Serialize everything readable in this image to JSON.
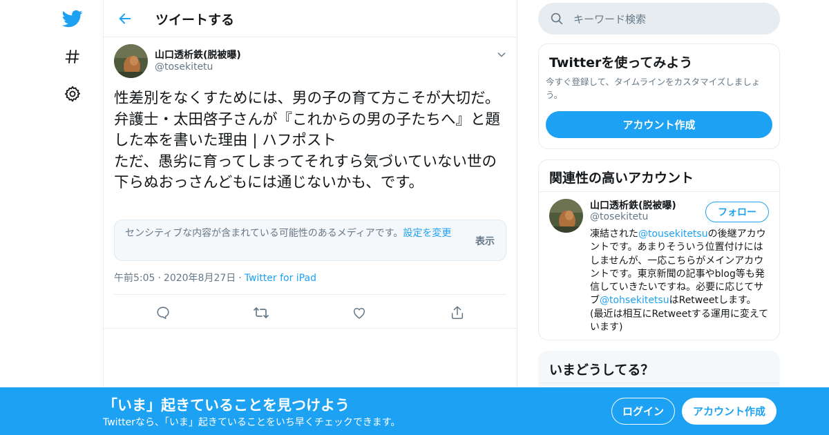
{
  "colors": {
    "accent": "#1da1f2",
    "text": "#14171a",
    "muted": "#657786",
    "border": "#e6ecf0"
  },
  "nav": {
    "icons": [
      "twitter-bird-icon",
      "hashtag-icon",
      "gear-icon"
    ]
  },
  "header": {
    "title": "ツイートする"
  },
  "tweet": {
    "author_name": "山口透析鉄(脱被曝)",
    "author_handle": "@tosekitetu",
    "text": "性差別をなくすためには、男の子の育て方こそが大切だ。弁護士・太田啓子さんが『これからの男の子たちへ』と題した本を書いた理由 | ハフポスト\nただ、愚劣に育ってしまってそれすら気づいていない世の下らぬおっさんどもには通じないかも、です。",
    "sensitive_text": "センシティブな内容が含まれている可能性のあるメディアです。",
    "sensitive_link": "設定を変更",
    "sensitive_show": "表示",
    "time": "午前5:05",
    "date": "2020年8月27日",
    "meta_sep": "·",
    "via": "Twitter for iPad",
    "actions": [
      "reply-icon",
      "retweet-icon",
      "like-icon",
      "share-icon"
    ]
  },
  "search": {
    "placeholder": "キーワード検索"
  },
  "signup_card": {
    "title": "Twitterを使ってみよう",
    "description": "今すぐ登録して、タイムラインをカスタマイズしましょう。",
    "button": "アカウント作成"
  },
  "related": {
    "title": "関連性の高いアカウント",
    "name": "山口透析鉄(脱被曝)",
    "handle": "@tosekitetu",
    "follow": "フォロー",
    "bio_1": "凍結された",
    "bio_mention_1": "@tousekitetsu",
    "bio_2": "の後継アカウントです。あまりそういう位置付けにはしませんが、一応こちらがメインアカウントです。東京新聞の記事やblog等も発信していきたいですね。必要に応じてサブ",
    "bio_mention_2": "@tohsekitetsu",
    "bio_3": "はRetweetします。 (最近は相互にRetweetする運用に変えています)"
  },
  "trends": {
    "title": "いまどうしてる？"
  },
  "bottom_bar": {
    "title": "「いま」起きていることを見つけよう",
    "subtitle": "Twitterなら、「いま」起きていることをいち早くチェックできます。",
    "login": "ログイン",
    "signup": "アカウント作成"
  }
}
